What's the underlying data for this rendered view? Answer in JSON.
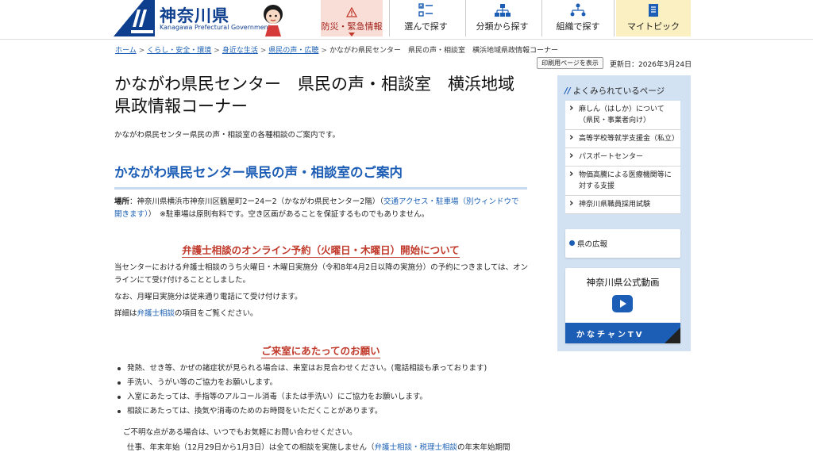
{
  "header": {
    "logo_name": "神奈川県",
    "logo_en": "Kanagawa Prefectural Government",
    "nav": [
      {
        "label": "防災・緊急情報",
        "icon": "warning-icon"
      },
      {
        "label": "選んで探す",
        "icon": "checklist-icon"
      },
      {
        "label": "分類から探す",
        "icon": "hierarchy-icon"
      },
      {
        "label": "組織で探す",
        "icon": "organization-icon"
      },
      {
        "label": "マイトピック",
        "icon": "document-icon"
      }
    ]
  },
  "breadcrumb": {
    "items": [
      "ホーム",
      "くらし・安全・環境",
      "身近な生活",
      "県民の声・広聴"
    ],
    "current": "かながわ県民センター　県民の声・相談室　横浜地域県政情報コーナー"
  },
  "print_label": "印刷用ページを表示",
  "updated": "更新日：2026年3月24日",
  "main": {
    "title": "かながわ県民センター　県民の声・相談室　横浜地域県政情報コーナー",
    "lead": "かながわ県民センター県民の声・相談室の各種相談のご案内です。",
    "section_heading": "かながわ県民センター県民の声・相談室のご案内",
    "place_label": "場所",
    "place_text": "：神奈川県横浜市神奈川区鶴屋町2ー24ー2（かながわ県民センター2階）（",
    "place_link": "交通アクセス・駐車場（別ウィンドウで開きます）",
    "place_note": "）　※駐車場は原則有料です。空き区画があることを保証するものでもありません。",
    "online_heading": "弁護士相談のオンライン予約（火曜日・木曜日）開始について",
    "online_para1": "当センターにおける弁護士相談のうち火曜日・木曜日実施分（令和8年4月2日以降の実施分）の予約につきましては、オンラインにて受け付けることとしました。",
    "online_para2": "なお、月曜日実施分は従来通り電話にて受け付けます。",
    "detail_prefix": "詳細は",
    "detail_link": "弁護士相談",
    "detail_suffix": "の項目をご覧ください。",
    "visit_heading": "ご来室にあたってのお願い",
    "visit_items": [
      "発熱、せき等、かぜの諸症状が見られる場合は、来室はお見合わせください。(電話相談も承っております)",
      "手洗い、うがい等のご協力をお願いします。",
      "入室にあたっては、手指等のアルコール消毒（または手洗い）にご協力をお願いします。",
      "相談にあたっては、換気や消毒のためのお時間をいただくことがあります。"
    ],
    "inquiry": "ご不明な点がある場合は、いつでもお気軽にお問い合わせください。",
    "cut_text": "仕事、年末年始（12月29日から1月3日）は全ての相談を実施しません（",
    "cut_link": "弁護士相談・税理士相談",
    "cut_suffix": "の年末年始期間"
  },
  "sidebar": {
    "heading": "よくみられているページ",
    "items": [
      "麻しん（はしか）について（県民・事業者向け）",
      "高等学校等就学支援金（私立）",
      "パスポートセンター",
      "物価高騰による医療機関等に対する支援",
      "神奈川県職員採用試験"
    ],
    "koho": "県の広報",
    "video_title": "神奈川県公式動画",
    "video_label": "かなチャンTV"
  }
}
